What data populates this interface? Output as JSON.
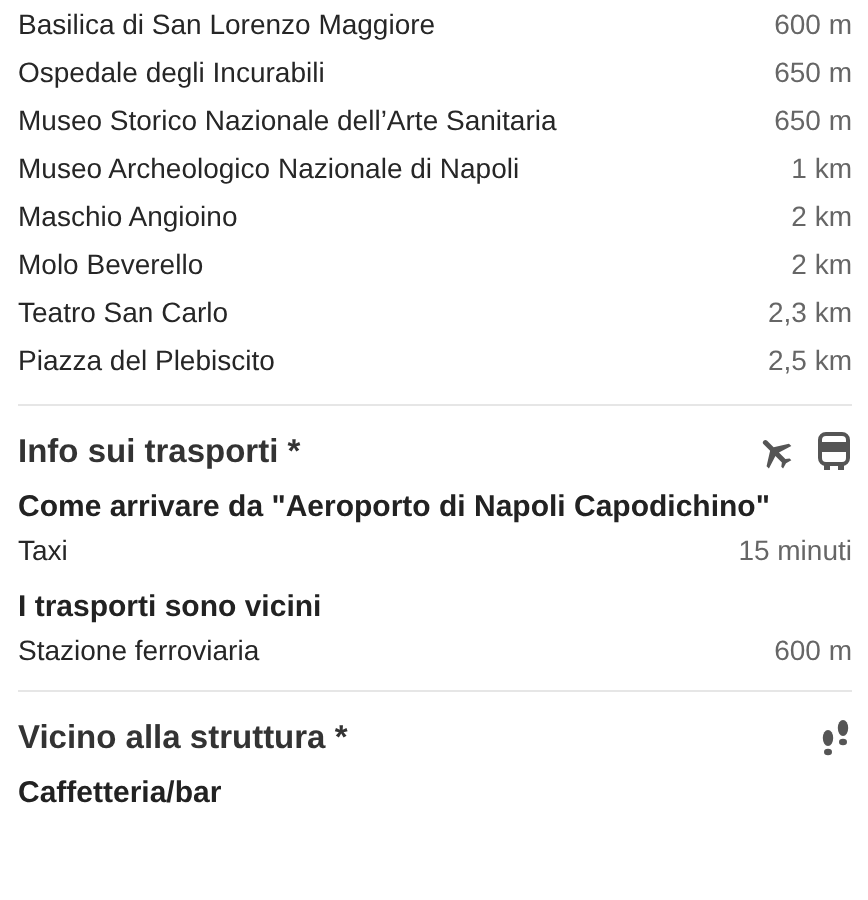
{
  "landmarks": [
    {
      "name": "Basilica di San Lorenzo Maggiore",
      "distance": "600 m"
    },
    {
      "name": "Ospedale degli Incurabili",
      "distance": "650 m"
    },
    {
      "name": "Museo Storico Nazionale dell’Arte Sanitaria",
      "distance": "650 m"
    },
    {
      "name": "Museo Archeologico Nazionale di Napoli",
      "distance": "1 km"
    },
    {
      "name": "Maschio Angioino",
      "distance": "2 km"
    },
    {
      "name": "Molo Beverello",
      "distance": "2 km"
    },
    {
      "name": "Teatro San Carlo",
      "distance": "2,3 km"
    },
    {
      "name": "Piazza del Plebiscito",
      "distance": "2,5 km"
    }
  ],
  "sections": [
    {
      "kind": "transport",
      "title": "Info sui trasporti *",
      "groups": [
        {
          "title": "Come arrivare da \"Aeroporto di Napoli Capodichino\"",
          "rows": [
            {
              "name": "Taxi",
              "value": "15 minuti"
            }
          ]
        },
        {
          "title": "I trasporti sono vicini",
          "rows": [
            {
              "name": "Stazione ferroviaria",
              "value": "600 m"
            }
          ]
        }
      ]
    },
    {
      "kind": "nearby",
      "title": "Vicino alla struttura *",
      "groups": [
        {
          "title": "Caffetteria/bar"
        }
      ]
    }
  ]
}
